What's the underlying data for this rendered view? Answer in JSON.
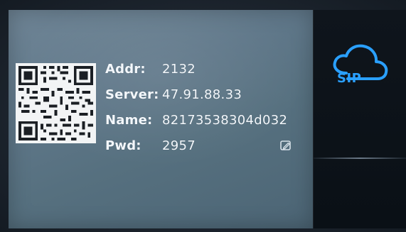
{
  "colors": {
    "screen_bg": "#5f7789",
    "text": "#f3f7fb",
    "sip_accent": "#2aa0ff",
    "sidebar_bg": "#0f151c"
  },
  "sip_panel": {
    "rows": [
      {
        "label": "Addr:",
        "value": "2132"
      },
      {
        "label": "Server:",
        "value": "47.91.88.33"
      },
      {
        "label": "Name:",
        "value": "82173538304d032"
      },
      {
        "label": "Pwd:",
        "value": "2957"
      }
    ],
    "qr_icon": "qr-code",
    "edit_icon": "edit-pencil-icon"
  },
  "sidebar": {
    "sip_label": "SIP",
    "cloud_icon": "cloud-icon"
  }
}
